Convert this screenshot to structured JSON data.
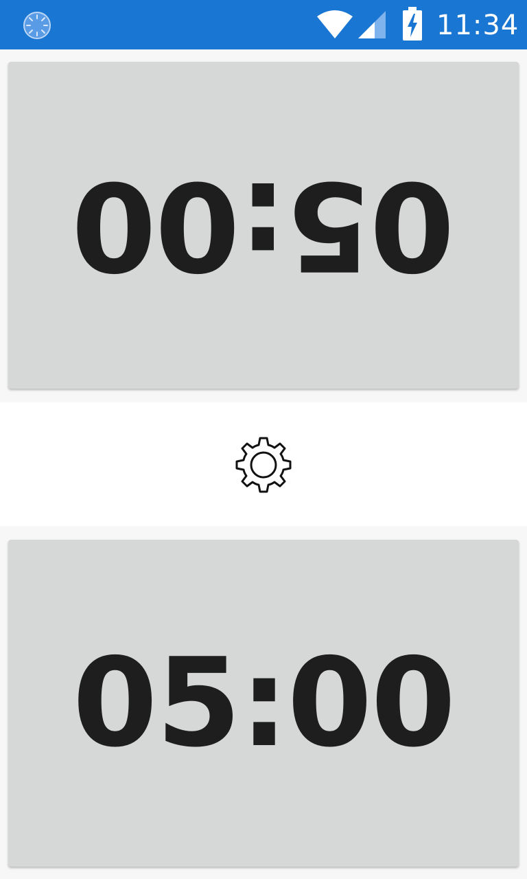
{
  "status_bar": {
    "time": "11:34",
    "background_color": "#1976d2",
    "icons": [
      "loading-icon",
      "wifi-icon",
      "signal-icon",
      "battery-charging-icon"
    ]
  },
  "timers": {
    "top": {
      "value": "05:00",
      "orientation": "rotated-180"
    },
    "bottom": {
      "value": "05:00",
      "orientation": "normal"
    },
    "panel_color": "#d6d7d7",
    "text_color": "#1e1e1e"
  },
  "settings": {
    "icon": "gear-icon"
  }
}
